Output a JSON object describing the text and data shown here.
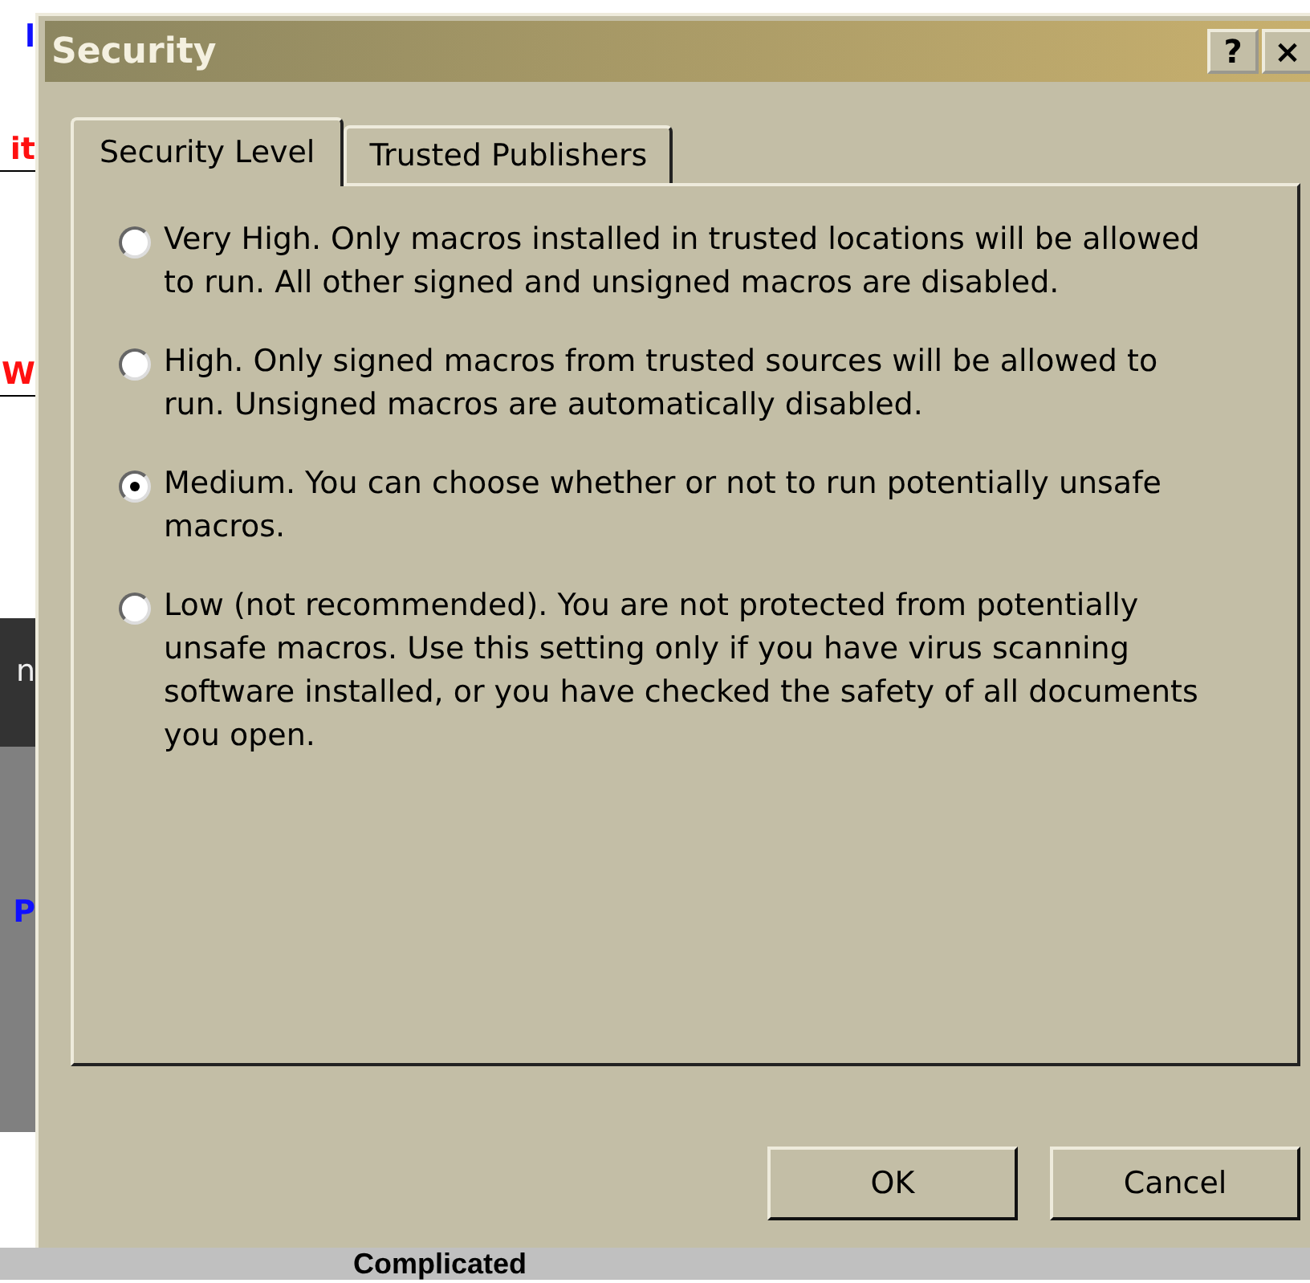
{
  "background": {
    "fragments": [
      "l",
      "it",
      "W",
      "n",
      "P"
    ],
    "bottom_text": "Complicated"
  },
  "window": {
    "title": "Security",
    "help_button": "?",
    "close_button": "×"
  },
  "tabs": [
    {
      "label": "Security Level",
      "selected": true
    },
    {
      "label": "Trusted Publishers",
      "selected": false
    }
  ],
  "options": [
    {
      "label": "Very High. Only macros installed in trusted locations will be allowed to run. All other signed and unsigned macros are disabled.",
      "selected": false
    },
    {
      "label": "High. Only signed macros from trusted sources will be allowed to run. Unsigned macros are automatically disabled.",
      "selected": false
    },
    {
      "label": "Medium. You can choose whether or not to run potentially unsafe macros.",
      "selected": true
    },
    {
      "label": "Low (not recommended). You are not protected from potentially unsafe macros. Use this setting only if you have virus scanning software installed, or you have checked the safety of all documents you open.",
      "selected": false
    }
  ],
  "buttons": [
    "OK",
    "Cancel"
  ]
}
